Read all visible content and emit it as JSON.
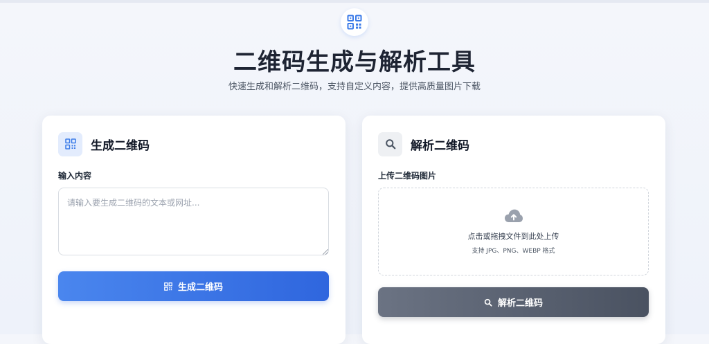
{
  "header": {
    "title": "二维码生成与解析工具",
    "subtitle": "快速生成和解析二维码，支持自定义内容，提供高质量图片下载",
    "logo_icon": "qrcode-icon"
  },
  "generate_card": {
    "icon": "qrcode-icon",
    "title": "生成二维码",
    "input_label": "输入内容",
    "input_placeholder": "请输入要生成二维码的文本或网址...",
    "input_value": "",
    "button_icon": "qrcode-icon",
    "button_label": "生成二维码"
  },
  "parse_card": {
    "icon": "search-icon",
    "title": "解析二维码",
    "upload_label": "上传二维码图片",
    "dropzone_icon": "cloud-upload-icon",
    "dropzone_text": "点击或拖拽文件到此处上传",
    "dropzone_hint": "支持 JPG、PNG、WEBP 格式",
    "button_icon": "search-icon",
    "button_label": "解析二维码"
  },
  "colors": {
    "primary": "#3b7be8",
    "secondary": "#5c6474",
    "background": "#f1f4fa"
  }
}
